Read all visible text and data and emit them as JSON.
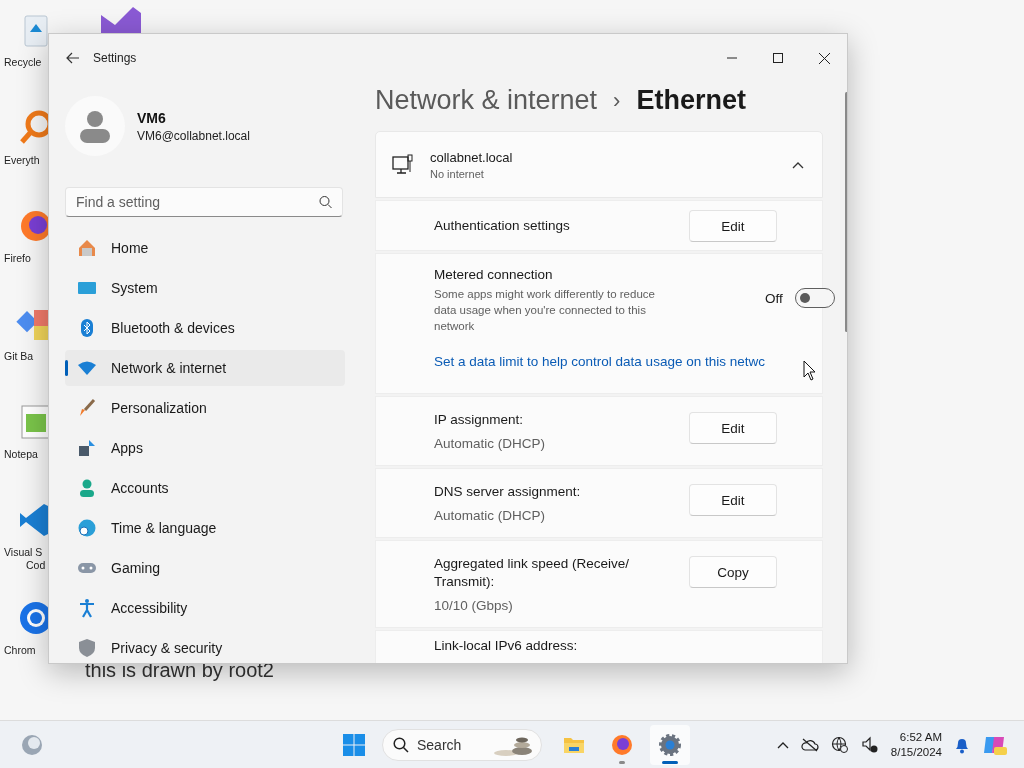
{
  "desktop": {
    "icons": [
      {
        "kind": "recycle",
        "lines": [
          "Recycle"
        ]
      },
      {
        "kind": "everything",
        "lines": [
          "Everyth"
        ]
      },
      {
        "kind": "firefox",
        "lines": [
          "Firefo"
        ]
      },
      {
        "kind": "git",
        "lines": [
          "Git Ba"
        ]
      },
      {
        "kind": "notepad",
        "lines": [
          "Notepa"
        ]
      },
      {
        "kind": "vscode",
        "lines": [
          "Visual S",
          "Cod"
        ]
      },
      {
        "kind": "chrome",
        "lines": [
          "Chrom"
        ]
      }
    ],
    "note": "this is drawn by root2"
  },
  "window": {
    "title": "Settings",
    "user": {
      "name": "VM6",
      "email": "VM6@collabnet.local"
    },
    "search": {
      "placeholder": "Find a setting"
    },
    "nav": [
      {
        "kind": "home",
        "label": "Home",
        "selected": false
      },
      {
        "kind": "system",
        "label": "System",
        "selected": false
      },
      {
        "kind": "bluetooth",
        "label": "Bluetooth & devices",
        "selected": false
      },
      {
        "kind": "network",
        "label": "Network & internet",
        "selected": true
      },
      {
        "kind": "personalization",
        "label": "Personalization",
        "selected": false
      },
      {
        "kind": "apps",
        "label": "Apps",
        "selected": false
      },
      {
        "kind": "accounts",
        "label": "Accounts",
        "selected": false
      },
      {
        "kind": "time",
        "label": "Time & language",
        "selected": false
      },
      {
        "kind": "gaming",
        "label": "Gaming",
        "selected": false
      },
      {
        "kind": "accessibility",
        "label": "Accessibility",
        "selected": false
      },
      {
        "kind": "privacy",
        "label": "Privacy & security",
        "selected": false
      }
    ],
    "breadcrumb": {
      "parent": "Network & internet",
      "separator": "›",
      "current": "Ethernet"
    },
    "connection": {
      "name": "collabnet.local",
      "status": "No internet",
      "expanded": true
    },
    "rows": [
      {
        "kind": "button",
        "label": "Authentication settings",
        "button": "Edit"
      },
      {
        "kind": "toggle",
        "label": "Metered connection",
        "description": "Some apps might work differently to reduce data usage when you're connected to this network",
        "state_label": "Off",
        "on": false,
        "link": "Set a data limit to help control data usage on this netwc"
      },
      {
        "kind": "value_button",
        "label": "IP assignment:",
        "value": "Automatic (DHCP)",
        "button": "Edit"
      },
      {
        "kind": "value_button",
        "label": "DNS server assignment:",
        "value": "Automatic (DHCP)",
        "button": "Edit"
      },
      {
        "kind": "value_button",
        "label": "Aggregated link speed (Receive/ Transmit):",
        "value": "10/10 (Gbps)",
        "button": "Copy"
      },
      {
        "kind": "label",
        "label": "Link-local IPv6 address:"
      }
    ]
  },
  "taskbar": {
    "search_placeholder": "Search",
    "apps": [
      {
        "kind": "explorer",
        "selected": false,
        "running": false
      },
      {
        "kind": "firefox",
        "selected": false,
        "running": true
      },
      {
        "kind": "settings",
        "selected": true,
        "running": true
      }
    ],
    "time": "6:52 AM",
    "date": "8/15/2024"
  }
}
